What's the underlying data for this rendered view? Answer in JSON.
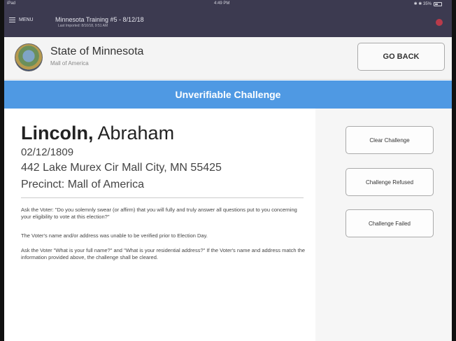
{
  "status_bar": {
    "carrier": "iPad",
    "time": "4:49 PM",
    "battery": "✱ ✱ 35%"
  },
  "app_bar": {
    "menu_label": "MENU",
    "training_title": "Minnesota Training #5 - 8/12/18",
    "last_imported": "Last Imported: 8/10/18, 9:51 AM"
  },
  "header": {
    "state_name": "State of Minnesota",
    "location": "Mall of America",
    "go_back_label": "GO BACK"
  },
  "banner": {
    "title": "Unverifiable Challenge"
  },
  "voter": {
    "last_name": "Lincoln,",
    "first_name": " Abraham",
    "dob": "02/12/1809",
    "address": "442 Lake Murex Cir Mall City, MN 55425",
    "precinct": "Precinct: Mall of America"
  },
  "instructions": {
    "p1": "Ask the Voter: \"Do you solemnly swear (or affirm) that you will fully and truly answer all questions put to you concerning your eligibility to vote at this election?\"",
    "p2": "The Voter's name and/or address was unable to be verified prior to Election Day.",
    "p3": "Ask the Voter \"What is your full name?\" and \"What is your residential address?\" If the Voter's name and address match the information provided above, the challenge shall be cleared."
  },
  "actions": {
    "clear": "Clear Challenge",
    "refused": "Challenge Refused",
    "failed": "Challenge Failed"
  },
  "colors": {
    "topbar": "#3c3a50",
    "banner": "#4f99e3",
    "alert": "#b83a4a"
  },
  "icons": {
    "menu": "hamburger-icon",
    "alert": "alert-icon",
    "battery": "battery-icon",
    "seal": "state-seal"
  }
}
